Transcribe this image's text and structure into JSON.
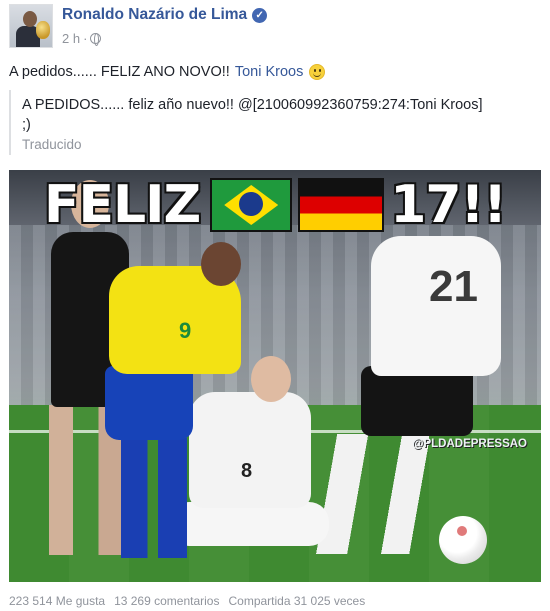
{
  "post": {
    "author_name": "Ronaldo Nazário de Lima",
    "time": "2 h",
    "separator": "·",
    "text": "A pedidos...... FELIZ ANO NOVO!!",
    "mention": "Toni Kroos"
  },
  "translation": {
    "line1": "A PEDIDOS...... feliz año nuevo!! @[210060992360759:274:Toni Kroos]",
    "line2": ";)",
    "label": "Traducido"
  },
  "image": {
    "headline_left": "FELIZ",
    "headline_right": "17!!",
    "watermark": "@PLDADEPRESSAO",
    "player_numbers": [
      "9",
      "8",
      "21"
    ]
  },
  "stats": {
    "likes": "223 514 Me gusta",
    "comments": "13 269 comentarios",
    "shares": "Compartida 31 025 veces"
  },
  "colors": {
    "link": "#365899",
    "meta": "#90949c",
    "verified": "#4267b2"
  },
  "icons": [
    "verified-badge-icon",
    "globe-icon",
    "smiley-icon"
  ]
}
